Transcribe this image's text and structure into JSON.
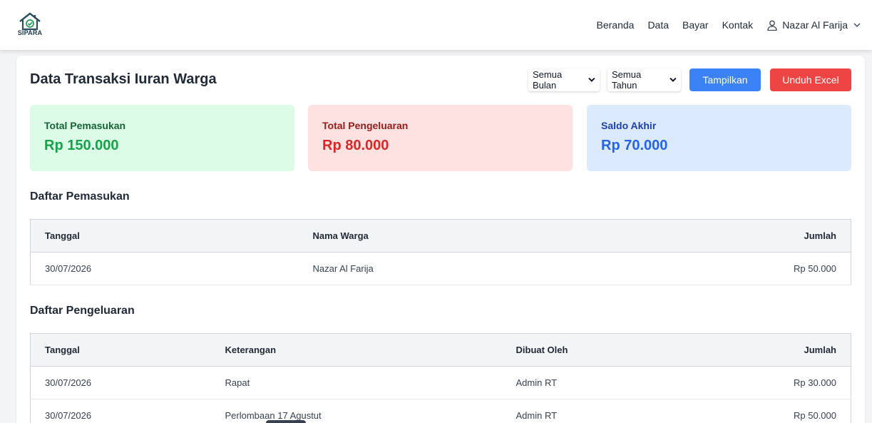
{
  "brand": {
    "logo_text": "SIPARA"
  },
  "nav": {
    "links": [
      "Beranda",
      "Data",
      "Bayar",
      "Kontak"
    ],
    "user_name": "Nazar Al Farija"
  },
  "page": {
    "title": "Data Transaksi Iuran Warga",
    "filters": {
      "bulan": "Semua Bulan",
      "tahun": "Semua Tahun"
    },
    "show_button": "Tampilkan",
    "export_button": "Unduh Excel"
  },
  "summary": {
    "income_label": "Total Pemasukan",
    "income_value": "Rp 150.000",
    "expense_label": "Total Pengeluaran",
    "expense_value": "Rp 80.000",
    "balance_label": "Saldo Akhir",
    "balance_value": "Rp 70.000"
  },
  "income": {
    "title": "Daftar Pemasukan",
    "headers": [
      "Tanggal",
      "Nama Warga",
      "Jumlah"
    ],
    "rows": [
      [
        "30/07/2026",
        "Nazar Al Farija",
        "Rp 50.000"
      ]
    ]
  },
  "expense": {
    "title": "Daftar Pengeluaran",
    "headers": [
      "Tanggal",
      "Keterangan",
      "Dibuat Oleh",
      "Jumlah"
    ],
    "rows": [
      [
        "30/07/2026",
        "Rapat",
        "Admin RT",
        "Rp 30.000"
      ],
      [
        "30/07/2026",
        "Perlombaan 17 Agustut",
        "Admin RT",
        "Rp 50.000"
      ]
    ]
  },
  "colors": {
    "primary": "#3b82f6",
    "danger": "#ef4444",
    "income_bg": "#dcfce7",
    "expense_bg": "#fee2e2",
    "balance_bg": "#dbeafe"
  }
}
